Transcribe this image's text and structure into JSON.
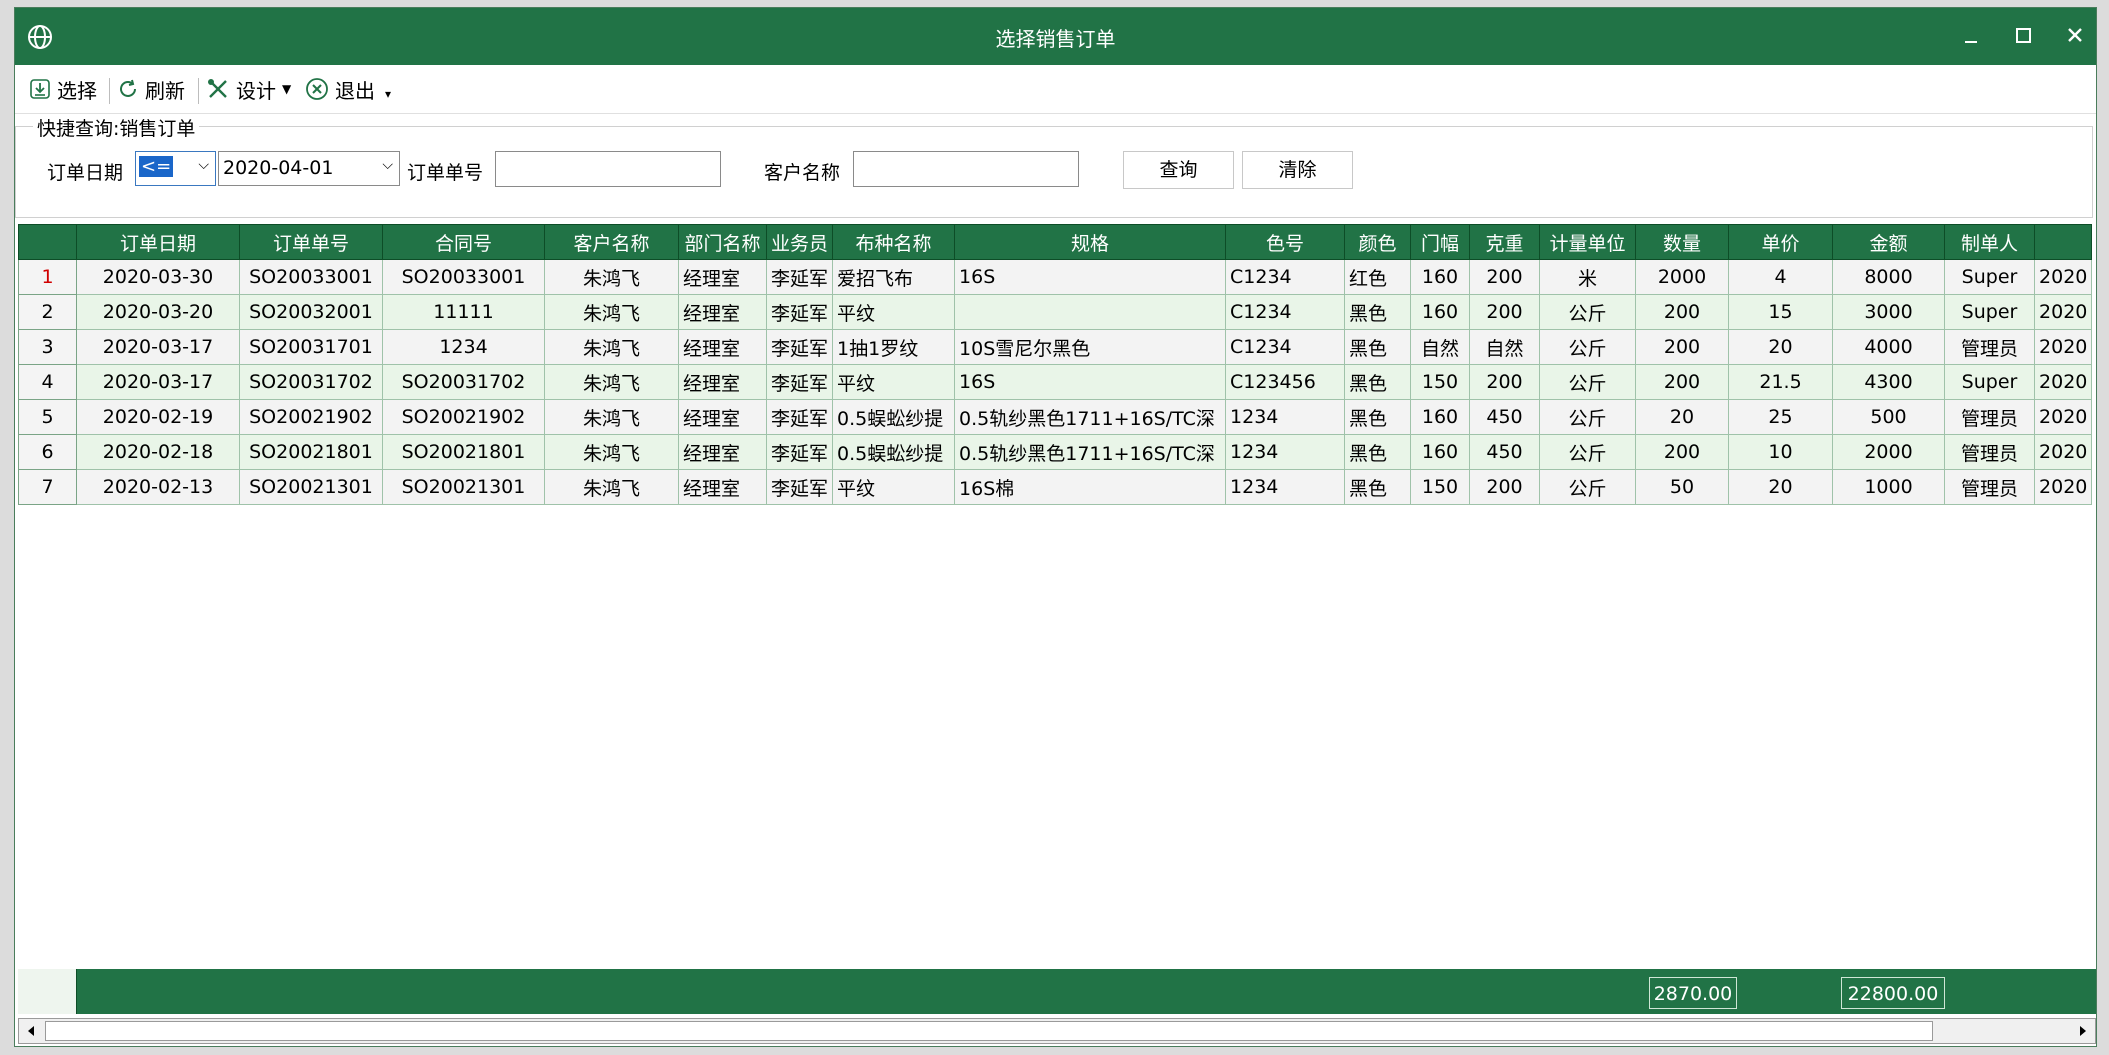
{
  "window": {
    "title": "选择销售订单"
  },
  "toolbar": {
    "select_label": "选择",
    "refresh_label": "刷新",
    "design_label": "设计",
    "exit_label": "退出"
  },
  "query": {
    "legend": "快捷查询:销售订单",
    "order_date_label": "订单日期",
    "operator_value": "<=",
    "date_value": "2020-04-01",
    "order_no_label": "订单单号",
    "order_no_value": "",
    "customer_label": "客户名称",
    "customer_value": "",
    "search_label": "查询",
    "clear_label": "清除"
  },
  "grid": {
    "columns": [
      "订单日期",
      "订单单号",
      "合同号",
      "客户名称",
      "部门名称",
      "业务员",
      "布种名称",
      "规格",
      "色号",
      "颜色",
      "门幅",
      "克重",
      "计量单位",
      "数量",
      "单价",
      "金额",
      "制单人",
      ""
    ],
    "rows": [
      {
        "no": "1",
        "cells": [
          "2020-03-30",
          "SO20033001",
          "SO20033001",
          "朱鸿飞",
          "经理室",
          "李延军",
          "爱招飞布",
          "16S",
          "C1234",
          "红色",
          "160",
          "200",
          "米",
          "2000",
          "4",
          "8000",
          "Super",
          "2020"
        ]
      },
      {
        "no": "2",
        "cells": [
          "2020-03-20",
          "SO20032001",
          "11111",
          "朱鸿飞",
          "经理室",
          "李延军",
          "平纹",
          "",
          "C1234",
          "黑色",
          "160",
          "200",
          "公斤",
          "200",
          "15",
          "3000",
          "Super",
          "2020"
        ]
      },
      {
        "no": "3",
        "cells": [
          "2020-03-17",
          "SO20031701",
          "1234",
          "朱鸿飞",
          "经理室",
          "李延军",
          "1抽1罗纹",
          "10S雪尼尔黑色",
          "C1234",
          "黑色",
          "自然",
          "自然",
          "公斤",
          "200",
          "20",
          "4000",
          "管理员",
          "2020"
        ]
      },
      {
        "no": "4",
        "cells": [
          "2020-03-17",
          "SO20031702",
          "SO20031702",
          "朱鸿飞",
          "经理室",
          "李延军",
          "平纹",
          "16S",
          "C123456",
          "黑色",
          "150",
          "200",
          "公斤",
          "200",
          "21.5",
          "4300",
          "Super",
          "2020"
        ]
      },
      {
        "no": "5",
        "cells": [
          "2020-02-19",
          "SO20021902",
          "SO20021902",
          "朱鸿飞",
          "经理室",
          "李延军",
          "0.5蜈蚣纱提",
          "0.5轨纱黑色1711+16S/TC深",
          "1234",
          "黑色",
          "160",
          "450",
          "公斤",
          "20",
          "25",
          "500",
          "管理员",
          "2020"
        ]
      },
      {
        "no": "6",
        "cells": [
          "2020-02-18",
          "SO20021801",
          "SO20021801",
          "朱鸿飞",
          "经理室",
          "李延军",
          "0.5蜈蚣纱提",
          "0.5轨纱黑色1711+16S/TC深",
          "1234",
          "黑色",
          "160",
          "450",
          "公斤",
          "200",
          "10",
          "2000",
          "管理员",
          "2020"
        ]
      },
      {
        "no": "7",
        "cells": [
          "2020-02-13",
          "SO20021301",
          "SO20021301",
          "朱鸿飞",
          "经理室",
          "李延军",
          "平纹",
          "16S棉",
          "1234",
          "黑色",
          "150",
          "200",
          "公斤",
          "50",
          "20",
          "1000",
          "管理员",
          "2020"
        ]
      }
    ]
  },
  "footer": {
    "qty_total": "2870.00",
    "amount_total": "22800.00"
  },
  "colors": {
    "titlebar": "#217346",
    "header": "#217346",
    "row_even": "#e9f5e8",
    "row_selected_no": "#d00000"
  }
}
